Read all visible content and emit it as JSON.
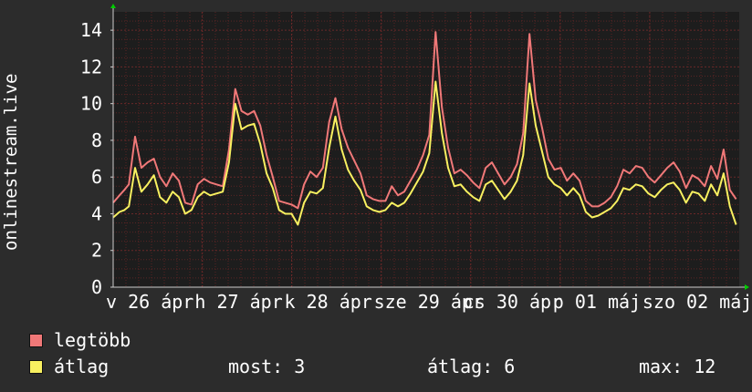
{
  "colors": {
    "background": "#2c2c2c",
    "plot_background": "#1d1d1d",
    "grid": "#5a2424",
    "axis": "#cccccc",
    "arrow": "#00cc00",
    "max_series": "#f07878",
    "avg_series": "#f8f060"
  },
  "chart_data": {
    "type": "line",
    "ylabel": "onlinestream.live",
    "ylim": [
      0,
      15
    ],
    "yticks": [
      0,
      2,
      4,
      6,
      8,
      10,
      12,
      14
    ],
    "xlim": [
      0,
      1000
    ],
    "xticks": [
      {
        "x": 0,
        "label": "v 26 ápr"
      },
      {
        "x": 142,
        "label": "h 27 ápr"
      },
      {
        "x": 285,
        "label": "k 28 ápr"
      },
      {
        "x": 428,
        "label": "sze 29 ápr"
      },
      {
        "x": 571,
        "label": "cs 30 ápr"
      },
      {
        "x": 714,
        "label": "p 01 máj"
      },
      {
        "x": 857,
        "label": "szo 02 máj"
      }
    ],
    "grid": true,
    "series": [
      {
        "name": "legtöbb",
        "color": "#f07878",
        "x": [
          0,
          10,
          18,
          25,
          35,
          45,
          55,
          65,
          75,
          85,
          95,
          105,
          115,
          125,
          135,
          145,
          155,
          165,
          175,
          185,
          195,
          205,
          215,
          225,
          235,
          245,
          255,
          265,
          275,
          285,
          295,
          305,
          315,
          325,
          335,
          345,
          355,
          365,
          375,
          385,
          395,
          405,
          415,
          425,
          435,
          445,
          455,
          465,
          475,
          485,
          495,
          505,
          515,
          525,
          535,
          545,
          555,
          565,
          575,
          585,
          595,
          605,
          615,
          625,
          635,
          645,
          655,
          665,
          675,
          685,
          695,
          705,
          715,
          725,
          735,
          745,
          755,
          765,
          775,
          785,
          795,
          805,
          815,
          825,
          835,
          845,
          855,
          865,
          875,
          885,
          895,
          905,
          915,
          925,
          935,
          945,
          955,
          965,
          975,
          985,
          995
        ],
        "y": [
          4.6,
          5.0,
          5.3,
          5.6,
          8.2,
          6.5,
          6.8,
          7.0,
          6.0,
          5.5,
          6.2,
          5.8,
          4.6,
          4.5,
          5.6,
          5.9,
          5.7,
          5.6,
          5.5,
          7.5,
          10.8,
          9.6,
          9.4,
          9.6,
          8.8,
          7.2,
          6.0,
          4.7,
          4.6,
          4.5,
          4.3,
          5.6,
          6.3,
          6.0,
          6.5,
          9.0,
          10.3,
          8.6,
          7.6,
          6.9,
          6.2,
          5.0,
          4.8,
          4.7,
          4.7,
          5.5,
          5.0,
          5.2,
          5.8,
          6.4,
          7.2,
          8.3,
          13.9,
          9.8,
          7.6,
          6.2,
          6.4,
          6.1,
          5.7,
          5.4,
          6.5,
          6.8,
          6.2,
          5.6,
          6.0,
          6.7,
          8.4,
          13.8,
          10.2,
          8.7,
          7.0,
          6.4,
          6.5,
          5.8,
          6.2,
          5.8,
          4.7,
          4.4,
          4.4,
          4.6,
          4.9,
          5.5,
          6.4,
          6.2,
          6.6,
          6.5,
          6.0,
          5.7,
          6.1,
          6.5,
          6.8,
          6.3,
          5.4,
          6.1,
          5.9,
          5.5,
          6.6,
          5.9,
          7.5,
          5.3,
          4.8
        ]
      },
      {
        "name": "átlag",
        "color": "#f8f060",
        "x": [
          0,
          10,
          18,
          25,
          35,
          45,
          55,
          65,
          75,
          85,
          95,
          105,
          115,
          125,
          135,
          145,
          155,
          165,
          175,
          185,
          195,
          205,
          215,
          225,
          235,
          245,
          255,
          265,
          275,
          285,
          295,
          305,
          315,
          325,
          335,
          345,
          355,
          365,
          375,
          385,
          395,
          405,
          415,
          425,
          435,
          445,
          455,
          465,
          475,
          485,
          495,
          505,
          515,
          525,
          535,
          545,
          555,
          565,
          575,
          585,
          595,
          605,
          615,
          625,
          635,
          645,
          655,
          665,
          675,
          685,
          695,
          705,
          715,
          725,
          735,
          745,
          755,
          765,
          775,
          785,
          795,
          805,
          815,
          825,
          835,
          845,
          855,
          865,
          875,
          885,
          895,
          905,
          915,
          925,
          935,
          945,
          955,
          965,
          975,
          985,
          995
        ],
        "y": [
          3.8,
          4.1,
          4.2,
          4.4,
          6.5,
          5.2,
          5.6,
          6.1,
          4.9,
          4.6,
          5.2,
          4.9,
          4.0,
          4.2,
          4.9,
          5.2,
          5.0,
          5.1,
          5.2,
          6.8,
          10.0,
          8.6,
          8.8,
          8.9,
          7.8,
          6.2,
          5.4,
          4.2,
          4.0,
          4.0,
          3.4,
          4.6,
          5.2,
          5.1,
          5.4,
          7.6,
          9.3,
          7.5,
          6.4,
          5.8,
          5.3,
          4.4,
          4.2,
          4.1,
          4.2,
          4.6,
          4.4,
          4.6,
          5.1,
          5.7,
          6.3,
          7.3,
          11.2,
          8.4,
          6.5,
          5.5,
          5.6,
          5.2,
          4.9,
          4.7,
          5.6,
          5.8,
          5.3,
          4.8,
          5.2,
          5.8,
          7.2,
          11.1,
          8.8,
          7.4,
          6.0,
          5.6,
          5.4,
          5.0,
          5.4,
          5.0,
          4.1,
          3.8,
          3.9,
          4.1,
          4.3,
          4.7,
          5.4,
          5.3,
          5.6,
          5.5,
          5.1,
          4.9,
          5.3,
          5.6,
          5.7,
          5.3,
          4.6,
          5.2,
          5.1,
          4.7,
          5.6,
          5.0,
          6.2,
          4.4,
          3.4
        ]
      }
    ]
  },
  "legend": {
    "max_label": "legtöbb",
    "avg_label": "átlag"
  },
  "stats": {
    "now": "most: 3",
    "avg": "átlag: 6",
    "max": "max: 12"
  }
}
